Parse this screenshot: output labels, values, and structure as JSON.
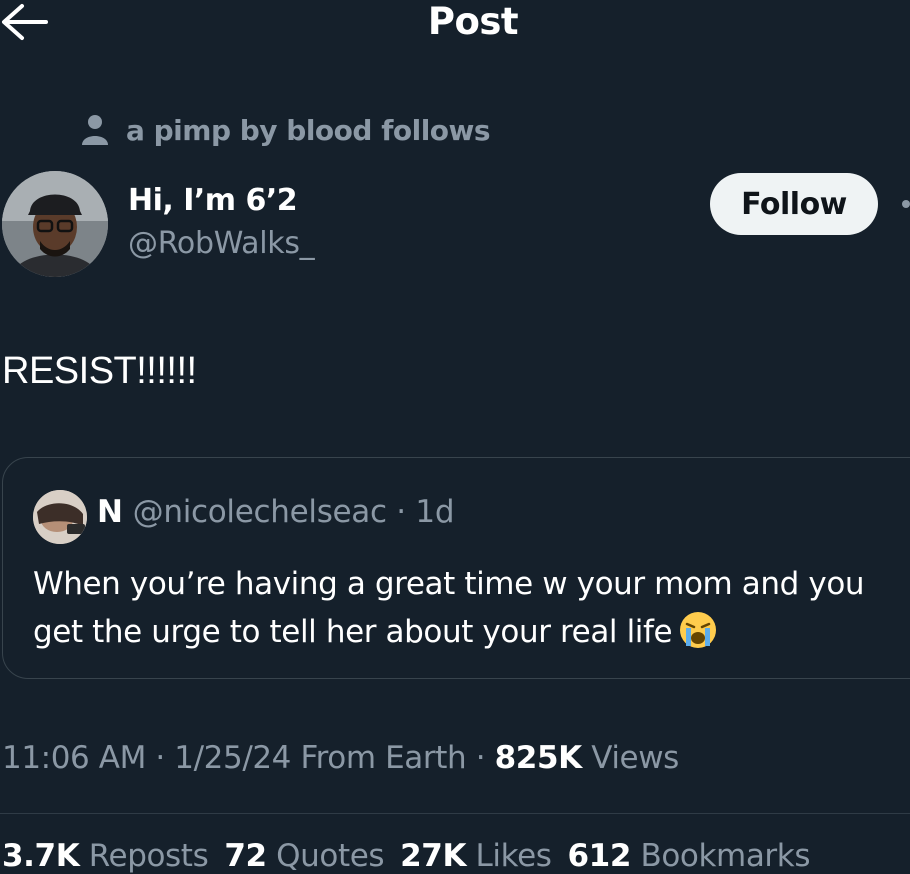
{
  "header": {
    "title": "Post",
    "back_icon": "arrow-left-icon"
  },
  "social_context": {
    "icon": "person-icon",
    "text": "a pimp by blood follows"
  },
  "author": {
    "display_name": "Hi, I’m 6’2",
    "handle": "@RobWalks_"
  },
  "follow_button": {
    "label": "Follow"
  },
  "post": {
    "text": "RESIST!!!!!!"
  },
  "quoted_post": {
    "name": "N",
    "meta": "@nicolechelseac · 1d",
    "line1": "When you’re having a great time w your mom and you",
    "line2": "get the urge to tell her about your real life",
    "emoji": "loudly-crying-face-icon"
  },
  "timestamp": {
    "time_date": "11:06 AM · 1/25/24 From Earth · ",
    "views_count": "825K",
    "views_label": " Views"
  },
  "stats": {
    "reposts_count": "3.7K",
    "reposts_label": " Reposts",
    "quotes_count": "72",
    "quotes_label": " Quotes",
    "likes_count": "27K",
    "likes_label": " Likes",
    "bookmarks_count": "612",
    "bookmarks_label": " Bookmarks"
  },
  "colors": {
    "background": "#15202b",
    "secondary_text": "#8b98a5",
    "border": "#38444d",
    "follow_bg": "#eff3f4"
  }
}
